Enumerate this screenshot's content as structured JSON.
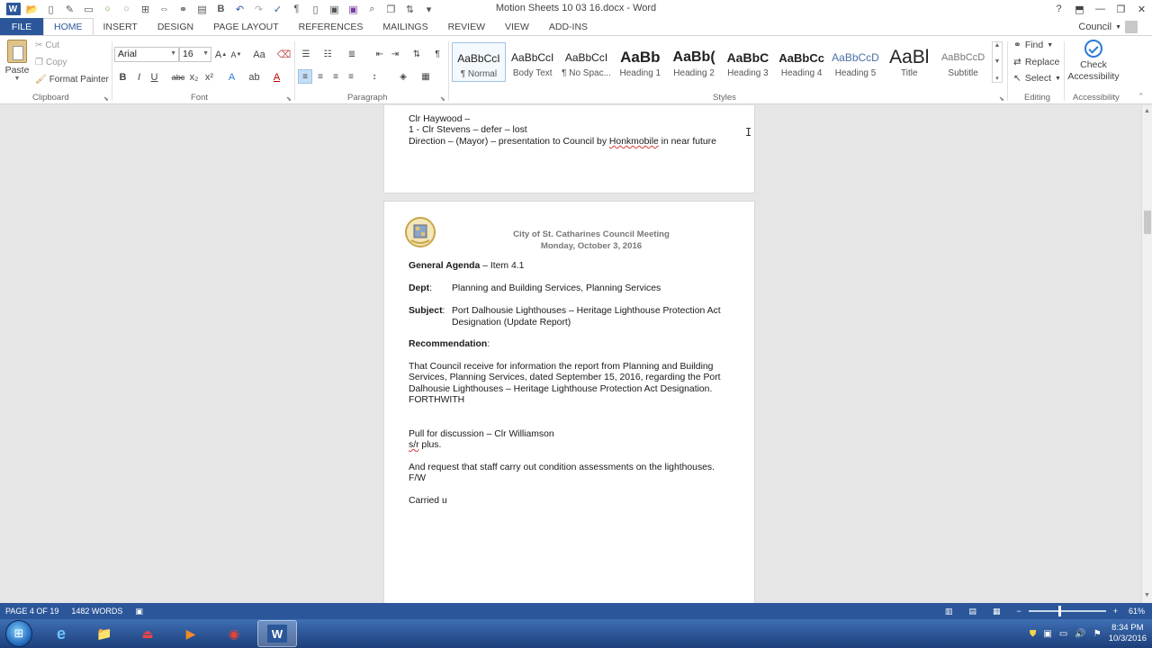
{
  "window": {
    "title": "Motion Sheets 10 03 16.docx - Word",
    "account": "Council",
    "help": "?"
  },
  "tabs": [
    "FILE",
    "HOME",
    "INSERT",
    "DESIGN",
    "PAGE LAYOUT",
    "REFERENCES",
    "MAILINGS",
    "REVIEW",
    "VIEW",
    "ADD-INS"
  ],
  "active_tab": "HOME",
  "ribbon": {
    "clipboard": {
      "paste": "Paste",
      "cut": "Cut",
      "copy": "Copy",
      "format_painter": "Format Painter",
      "label": "Clipboard"
    },
    "font": {
      "name": "Arial",
      "size": "16",
      "label": "Font",
      "bold": "B",
      "italic": "I",
      "underline": "U",
      "strike": "abc",
      "sub": "x₂",
      "sup": "x²",
      "grow": "A",
      "shrink": "A",
      "case": "Aa"
    },
    "paragraph": {
      "label": "Paragraph"
    },
    "styles": {
      "label": "Styles",
      "items": [
        {
          "sample": "AaBbCcI",
          "name": "¶ Normal"
        },
        {
          "sample": "AaBbCcI",
          "name": "Body Text"
        },
        {
          "sample": "AaBbCcI",
          "name": "¶ No Spac..."
        },
        {
          "sample": "AaBb",
          "name": "Heading 1"
        },
        {
          "sample": "AaBb(",
          "name": "Heading 2"
        },
        {
          "sample": "AaBbC",
          "name": "Heading 3"
        },
        {
          "sample": "AaBbCc",
          "name": "Heading 4"
        },
        {
          "sample": "AaBbCcD",
          "name": "Heading 5"
        },
        {
          "sample": "AaBl",
          "name": "Title"
        },
        {
          "sample": "AaBbCcD",
          "name": "Subtitle"
        }
      ]
    },
    "editing": {
      "label": "Editing",
      "find": "Find",
      "replace": "Replace",
      "select": "Select"
    },
    "accessibility": {
      "label": "Accessibility",
      "check_line1": "Check",
      "check_line2": "Accessibility"
    }
  },
  "document": {
    "page1": {
      "line1": "Clr Haywood –",
      "line2": "1 - Clr Stevens – defer – lost",
      "line3_a": "Direction – (Mayor) – presentation to Council by ",
      "line3_b": "Honkmobile",
      "line3_c": " in near future"
    },
    "page2": {
      "header_line1": "City of St. Catharines Council Meeting",
      "header_line2": "Monday, October 3, 2016",
      "agenda_bold": "General Agenda",
      "agenda_rest": " – Item 4.1",
      "dept_label": "Dept",
      "dept_value": "Planning and Building Services, Planning Services",
      "subject_label": "Subject",
      "subject_line1": "Port Dalhousie Lighthouses – Heritage Lighthouse Protection Act",
      "subject_line2": "Designation (Update Report)",
      "recommendation_label": "Recommendation",
      "rec_line1": "That Council receive for information the report from Planning and Building",
      "rec_line2": "Services, Planning Services, dated September 15, 2016, regarding the Port",
      "rec_line3": "Dalhousie Lighthouses – Heritage Lighthouse Protection Act Designation.",
      "rec_line4": "FORTHWITH",
      "pull_line": "Pull for discussion – Clr Williamson",
      "sr_a": "s/r",
      "sr_b": " plus.",
      "request_line1": "And request that staff carry out condition assessments on the lighthouses.",
      "request_line2": "F/W",
      "carried": "Carried u"
    }
  },
  "status": {
    "page": "PAGE 4 OF 19",
    "words": "1482 WORDS",
    "zoom": "61%",
    "zoom_fraction": 0.4
  },
  "taskbar": {
    "time": "8:34 PM",
    "date": "10/3/2016"
  },
  "colors": {
    "word_blue": "#2b579a",
    "taskbar": "#1c3f7a"
  }
}
